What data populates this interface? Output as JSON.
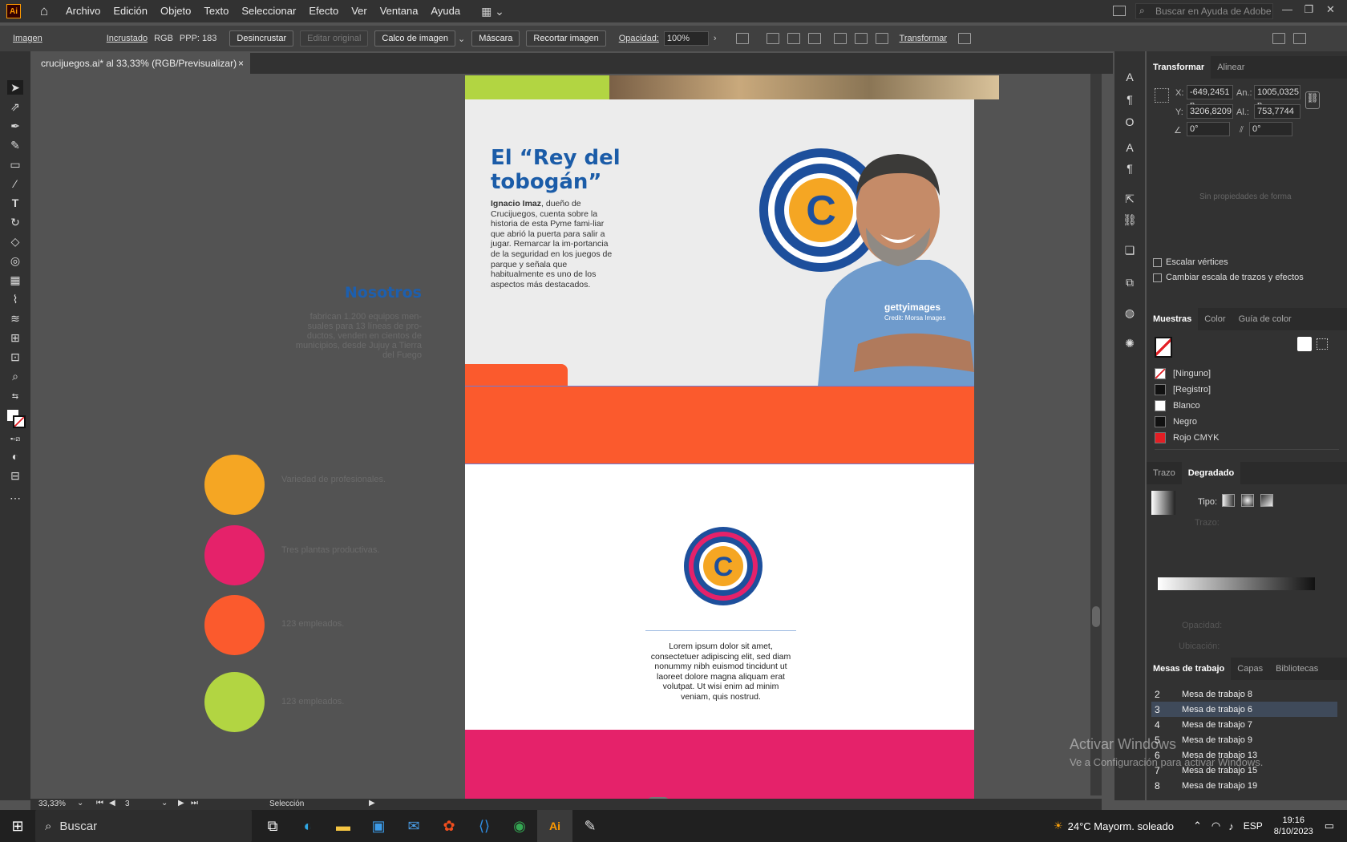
{
  "menubar": {
    "app_logo": "Ai",
    "items": [
      "Archivo",
      "Edición",
      "Objeto",
      "Texto",
      "Seleccionar",
      "Efecto",
      "Ver",
      "Ventana",
      "Ayuda"
    ],
    "search_placeholder": "Buscar en Ayuda de Adobe"
  },
  "controlbar": {
    "object_type": "Imagen",
    "embedded": "Incrustado",
    "color_mode": "RGB",
    "ppi": "PPP: 183",
    "unembed": "Desincrustar",
    "edit_original": "Editar original",
    "image_trace": "Calco de imagen",
    "mask": "Máscara",
    "crop_image": "Recortar imagen",
    "opacity_label": "Opacidad:",
    "opacity_value": "100%",
    "transform": "Transformar"
  },
  "document_tab": {
    "title": "crucijuegos.ai* al 33,33% (RGB/Previsualizar)",
    "close": "×"
  },
  "artboard": {
    "headline": "El “Rey del tobogán”",
    "intro_bold": "Ignacio Imaz",
    "intro_text": ", dueño de Crucijuegos, cuenta  sobre la historia de esta Pyme fami-liar que abrió la puerta para salir a jugar. Remarcar la im-portancia de la seguridad en los juegos de parque y señala que habitualmente es uno de los aspectos más destacados.",
    "getty": "gettyimages",
    "getty_credit": "Credit: Morsa Images",
    "logo_letter": "C",
    "lorem": "Lorem ipsum dolor sit amet, consectetuer adipiscing elit, sed diam nonummy nibh euismod tincidunt ut laoreet dolore magna aliquam erat volutpat. Ut wisi enim ad minim veniam, quis nostrud."
  },
  "pasteboard": {
    "nosotros_title": "Nosotros",
    "nosotros_text": "fabrican 1.200 equipos men-suales para 13 líneas de pro-ductos, venden en cientos de municipios, desde Jujuy a Tierra del Fuego",
    "circles": [
      {
        "color": "#f5a623",
        "label": "Variedad de profesionales."
      },
      {
        "color": "#e5226a",
        "label": "Tres plantas productivas."
      },
      {
        "color": "#fb5a2d",
        "label": "123 empleados."
      },
      {
        "color": "#b2d542",
        "label": "123 empleados."
      }
    ]
  },
  "transform_panel": {
    "tabs": [
      "Transformar",
      "Alinear"
    ],
    "x_label": "X:",
    "x": "-649,2451 p",
    "y_label": "Y:",
    "y": "3206,8209 p",
    "w_label": "An.:",
    "w": "1005,0325 p",
    "h_label": "Al.:",
    "h": "753,7744 px",
    "angle": "0°",
    "shear": "0°",
    "no_shape": "Sin propiedades de forma",
    "scale_corners": "Escalar vértices",
    "scale_strokes": "Cambiar escala de trazos y efectos"
  },
  "swatches_panel": {
    "tabs": [
      "Muestras",
      "Color",
      "Guía de color"
    ],
    "items": [
      {
        "name": "[Ninguno]",
        "color": "#ffffff"
      },
      {
        "name": "[Registro]",
        "color": "#111111"
      },
      {
        "name": "Blanco",
        "color": "#ffffff"
      },
      {
        "name": "Negro",
        "color": "#111111"
      },
      {
        "name": "Rojo CMYK",
        "color": "#e31e24"
      }
    ]
  },
  "gradient_panel": {
    "tabs": [
      "Trazo",
      "Degradado"
    ],
    "type_label": "Tipo:",
    "stroke_label": "Trazo:",
    "opacity_label": "Opacidad:",
    "location_label": "Ubicación:"
  },
  "artboards_panel": {
    "tabs": [
      "Mesas de trabajo",
      "Capas",
      "Bibliotecas"
    ],
    "rows": [
      {
        "num": "2",
        "name": "Mesa de trabajo 8"
      },
      {
        "num": "3",
        "name": "Mesa de trabajo 6"
      },
      {
        "num": "4",
        "name": "Mesa de trabajo 7"
      },
      {
        "num": "5",
        "name": "Mesa de trabajo 9"
      },
      {
        "num": "6",
        "name": "Mesa de trabajo 13"
      },
      {
        "num": "7",
        "name": "Mesa de trabajo 15"
      },
      {
        "num": "8",
        "name": "Mesa de trabajo 19"
      }
    ]
  },
  "statusbar": {
    "zoom": "33,33%",
    "page": "3",
    "tool": "Selección"
  },
  "watermark": {
    "line1": "Activar Windows",
    "line2": "Ve a Configuración para activar Windows."
  },
  "taskbar": {
    "search_placeholder": "Buscar",
    "weather": "24°C  Mayorm. soleado",
    "lang": "ESP",
    "time": "19:16",
    "date": "8/10/2023"
  }
}
